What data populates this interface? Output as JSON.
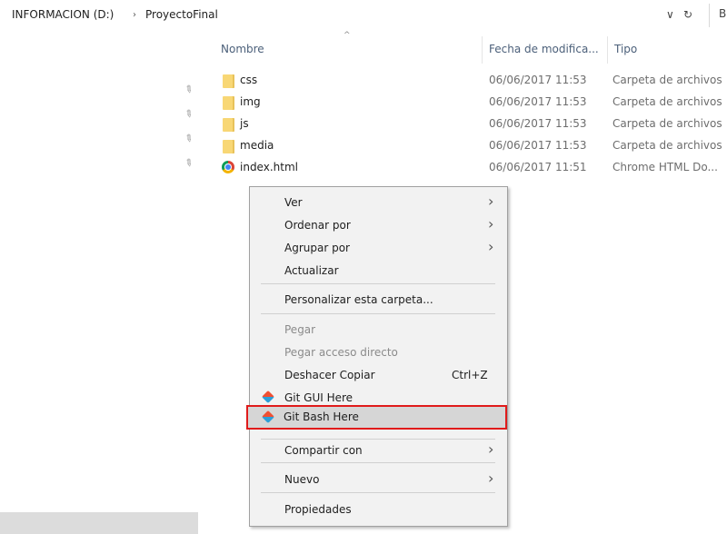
{
  "addressbar": {
    "drive": "INFORMACION (D:)",
    "separator": "›",
    "folder": "ProyectoFinal",
    "dropdown_icon": "chevron-down-icon",
    "refresh_icon": "refresh-icon",
    "dropdown_glyph": "∨",
    "refresh_glyph": "↻",
    "partial_text": "B"
  },
  "columns": {
    "name": "Nombre",
    "date": "Fecha de modifica...",
    "type": "Tipo",
    "sort_glyph": "^"
  },
  "files": [
    {
      "name": "css",
      "date": "06/06/2017 11:53",
      "type": "Carpeta de archivos",
      "icon": "folder-icon"
    },
    {
      "name": "img",
      "date": "06/06/2017 11:53",
      "type": "Carpeta de archivos",
      "icon": "folder-icon"
    },
    {
      "name": "js",
      "date": "06/06/2017 11:53",
      "type": "Carpeta de archivos",
      "icon": "folder-icon"
    },
    {
      "name": "media",
      "date": "06/06/2017 11:53",
      "type": "Carpeta de archivos",
      "icon": "folder-icon"
    },
    {
      "name": "index.html",
      "date": "06/06/2017 11:51",
      "type": "Chrome HTML Do...",
      "icon": "chrome-icon"
    }
  ],
  "pin_glyph": "📌",
  "context_menu": {
    "items": [
      {
        "label": "Ver",
        "submenu": true
      },
      {
        "label": "Ordenar por",
        "submenu": true
      },
      {
        "label": "Agrupar por",
        "submenu": true
      },
      {
        "label": "Actualizar"
      },
      {
        "label": "Personalizar esta carpeta..."
      },
      {
        "label": "Pegar",
        "disabled": true
      },
      {
        "label": "Pegar acceso directo",
        "disabled": true
      },
      {
        "label": "Deshacer Copiar",
        "shortcut": "Ctrl+Z"
      },
      {
        "label": "Git GUI Here",
        "icon": "git-icon"
      },
      {
        "label": "Git Bash Here",
        "icon": "git-icon",
        "highlighted": true
      },
      {
        "label": "Compartir con",
        "submenu": true
      },
      {
        "label": "Nuevo",
        "submenu": true
      },
      {
        "label": "Propiedades"
      }
    ],
    "arrow_glyph": "›",
    "highlight_color": "#e01b1b"
  }
}
